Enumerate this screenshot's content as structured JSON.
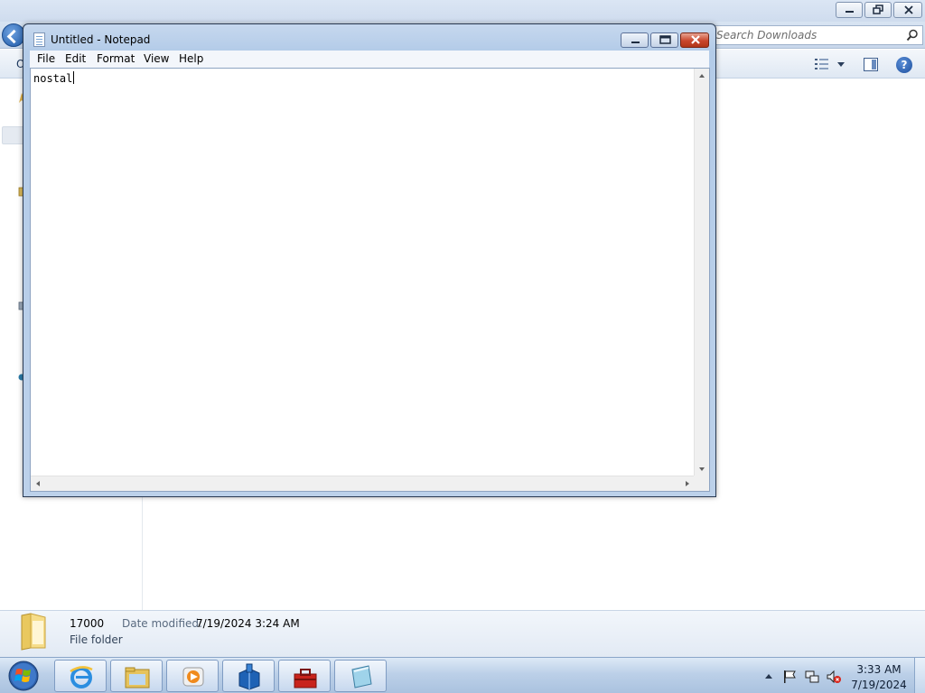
{
  "explorer": {
    "search_placeholder": "Search Downloads",
    "toolbar_first_letter": "O",
    "details": {
      "name": "17000",
      "date_modified_label": "Date modified:",
      "date_modified_value": "7/19/2024 3:24 AM",
      "type": "File folder"
    },
    "icons": {
      "back": "back-arrow-icon",
      "search": "magnifier-icon",
      "views": "views-list-icon",
      "preview": "preview-pane-icon",
      "help": "help-icon",
      "folder": "folder-icon"
    }
  },
  "notepad": {
    "title": "Untitled - Notepad",
    "menu": [
      "File",
      "Edit",
      "Format",
      "View",
      "Help"
    ],
    "content": "nostal"
  },
  "taskbar": {
    "pinned": [
      {
        "name": "internet-explorer",
        "icon": "ie-icon"
      },
      {
        "name": "windows-explorer",
        "icon": "folder-icon"
      },
      {
        "name": "media-player",
        "icon": "media-player-icon"
      },
      {
        "name": "app-blue-box",
        "icon": "package-icon"
      },
      {
        "name": "toolbox",
        "icon": "toolbox-icon"
      },
      {
        "name": "notepad",
        "icon": "notepad-icon"
      }
    ],
    "clock": {
      "time": "3:33 AM",
      "date": "7/19/2024"
    }
  },
  "colors": {
    "titlebar": "#c6d8ee",
    "close_button": "#c9462c",
    "taskbar": "#bcd0e8"
  }
}
